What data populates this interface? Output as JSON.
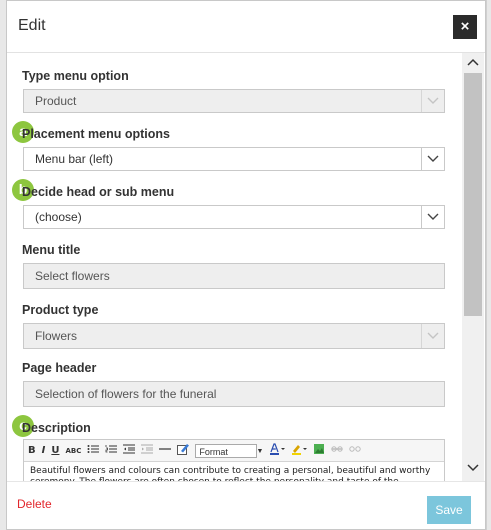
{
  "dialog": {
    "title": "Edit",
    "close_label": "×"
  },
  "fields": {
    "type_menu_option": {
      "label": "Type menu option",
      "value": "Product"
    },
    "placement_menu_options": {
      "label": "Placement menu options",
      "value": "Menu bar (left)"
    },
    "head_or_sub_menu": {
      "label": "Decide head or sub menu",
      "value": "(choose)"
    },
    "menu_title": {
      "label": "Menu title",
      "value": "Select flowers"
    },
    "product_type": {
      "label": "Product type",
      "value": "Flowers"
    },
    "page_header": {
      "label": "Page header",
      "value": "Selection of flowers for the funeral"
    },
    "description": {
      "label": "Description",
      "text": "Beautiful flowers and colours can contribute to creating a personal, beautiful and worthy ceremony. The flowers are often chosen to reflect the personality and taste of the"
    }
  },
  "badges": [
    "a",
    "b",
    "c"
  ],
  "editor_toolbar": {
    "bold": "B",
    "italic": "I",
    "underline": "U",
    "strike": "ABC",
    "format_select": "Format"
  },
  "footer": {
    "delete_label": "Delete",
    "save_label": "Save"
  },
  "colors": {
    "badge": "#8dc63f",
    "delete": "#e2262c",
    "save": "#7cc6dc",
    "close_bg": "#2b2b2b"
  }
}
